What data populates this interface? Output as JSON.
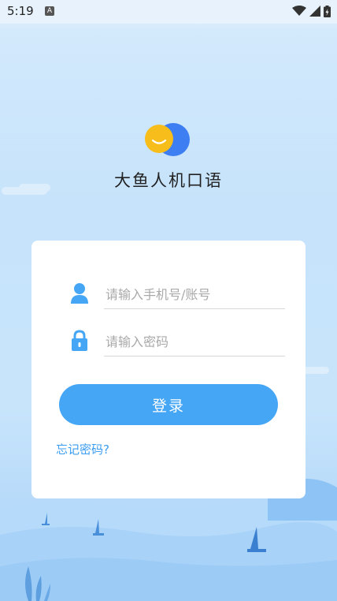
{
  "status": {
    "time": "5:19",
    "a_icon": "A"
  },
  "app": {
    "title": "大鱼人机口语"
  },
  "form": {
    "username_placeholder": "请输入手机号/账号",
    "password_placeholder": "请输入密码",
    "login_label": "登录",
    "forgot_label": "忘记密码?"
  },
  "icons": {
    "user": "user-icon",
    "lock": "lock-icon",
    "wifi": "wifi-icon",
    "signal": "signal-icon",
    "battery": "battery-icon"
  },
  "colors": {
    "accent": "#45a6f6",
    "link": "#3b9df2",
    "logo_yellow": "#f7bd1b",
    "logo_blue": "#3d7ff2"
  }
}
